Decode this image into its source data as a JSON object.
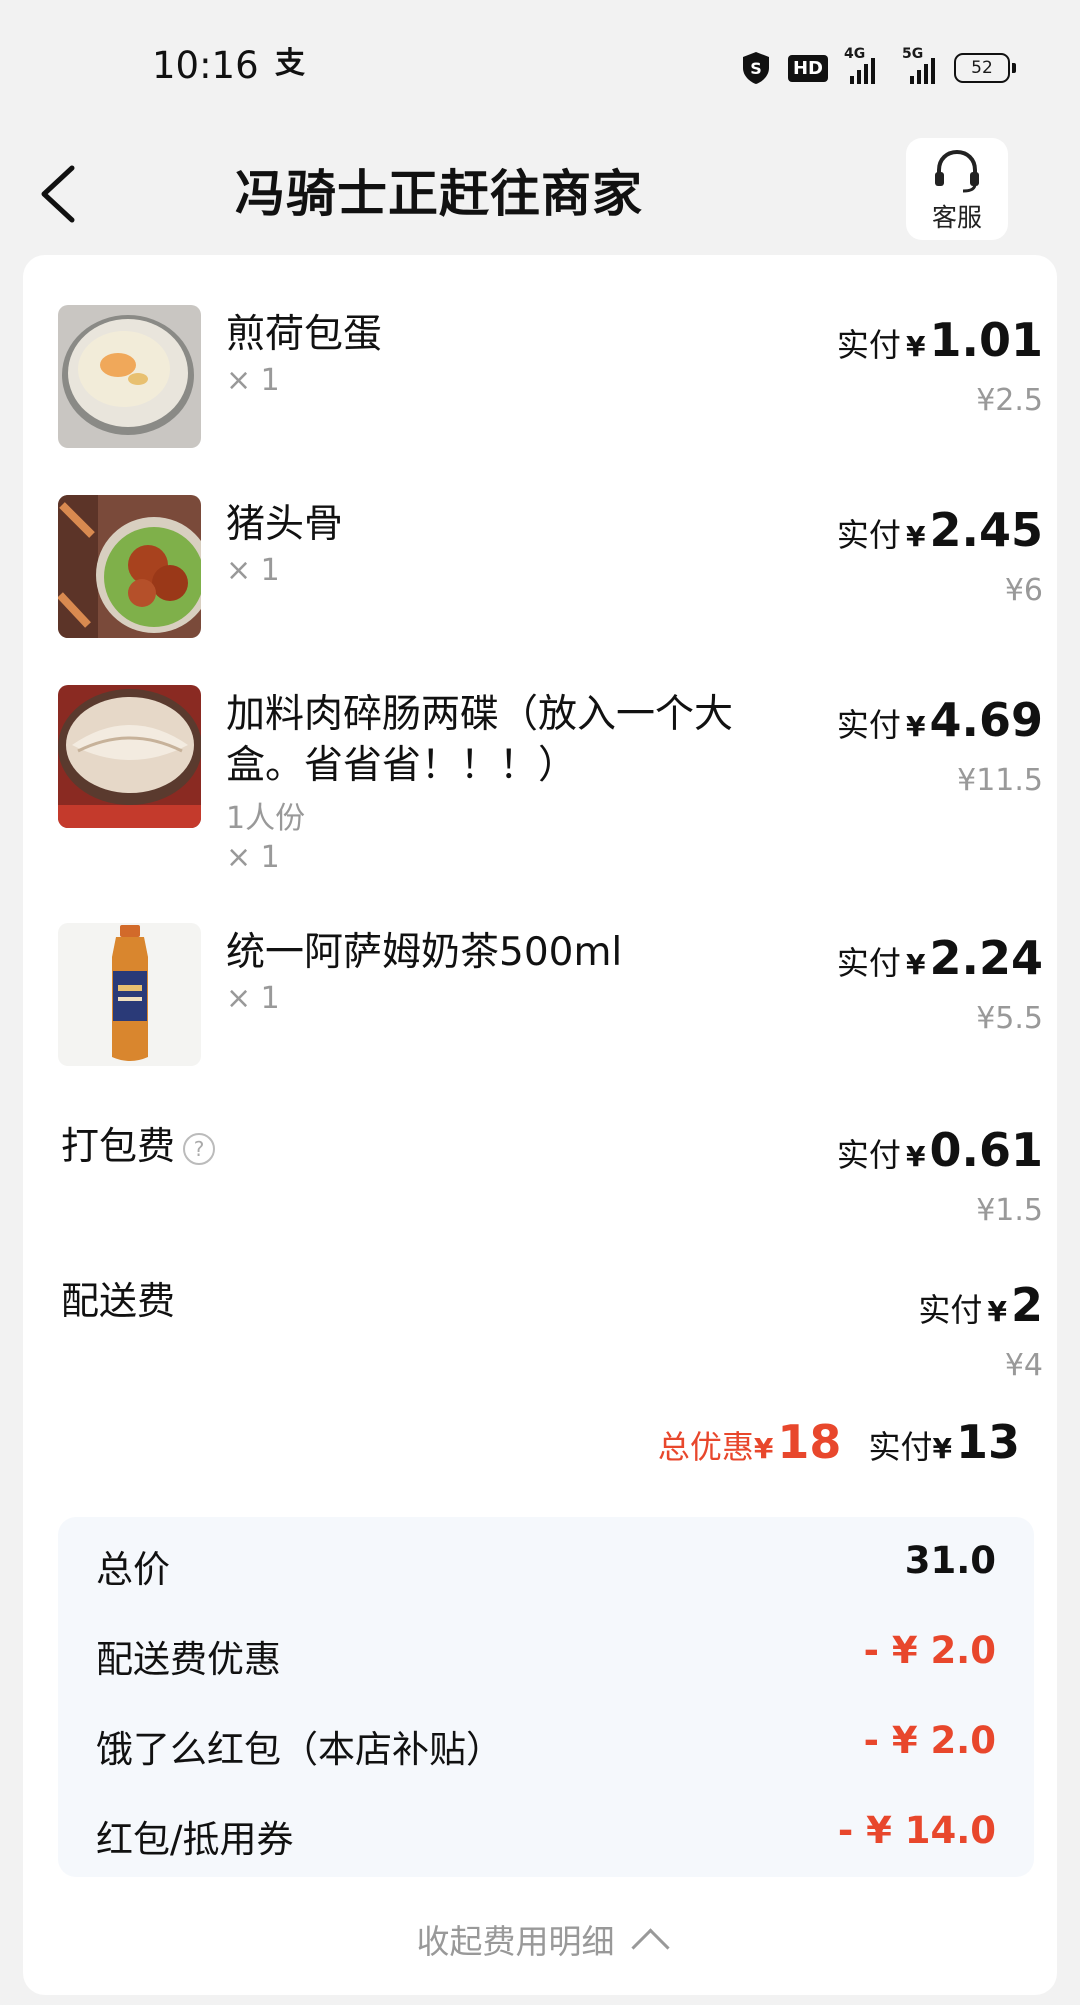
{
  "status_bar": {
    "time": "10:16",
    "app_icon": "alipay-icon",
    "hd": "HD",
    "sig1": "4G",
    "sig2": "5G",
    "battery": "52"
  },
  "header": {
    "title": "冯骑士正赶往商家",
    "service_label": "客服"
  },
  "items": [
    {
      "name": "煎荷包蛋",
      "quantity": "× 1",
      "pay_label": "实付",
      "yen": "¥",
      "paid": "1.01",
      "original": "¥2.5"
    },
    {
      "name": "猪头骨",
      "quantity": "× 1",
      "pay_label": "实付",
      "yen": "¥",
      "paid": "2.45",
      "original": "¥6"
    },
    {
      "name": "加料肉碎肠两碟（放入一个大盒。省省省！！！）",
      "spec": "1人份",
      "quantity": "× 1",
      "pay_label": "实付",
      "yen": "¥",
      "paid": "4.69",
      "original": "¥11.5"
    },
    {
      "name": "统一阿萨姆奶茶500ml",
      "quantity": "× 1",
      "pay_label": "实付",
      "yen": "¥",
      "paid": "2.24",
      "original": "¥5.5"
    }
  ],
  "fees": {
    "packing": {
      "label": "打包费",
      "help": "?",
      "pay_label": "实付",
      "yen": "¥",
      "paid": "0.61",
      "original": "¥1.5"
    },
    "delivery": {
      "label": "配送费",
      "pay_label": "实付",
      "yen": "¥",
      "paid": "2",
      "original": "¥4"
    }
  },
  "summary": {
    "discount_label": "总优惠",
    "yen": "¥",
    "discount_amount": "18",
    "pay_label": "实付",
    "paid": "13"
  },
  "breakdown": [
    {
      "label": "总价",
      "value": "31.0"
    },
    {
      "label": "配送费优惠",
      "value": "- ¥ 2.0"
    },
    {
      "label": "饿了么红包（本店补贴）",
      "value": "- ¥ 2.0"
    },
    {
      "label": "红包/抵用券",
      "value": "- ¥ 14.0"
    }
  ],
  "collapse_label": "收起费用明细",
  "colors": {
    "accent_red": "#e8472c",
    "breakdown_bg": "#f5f8fc"
  }
}
